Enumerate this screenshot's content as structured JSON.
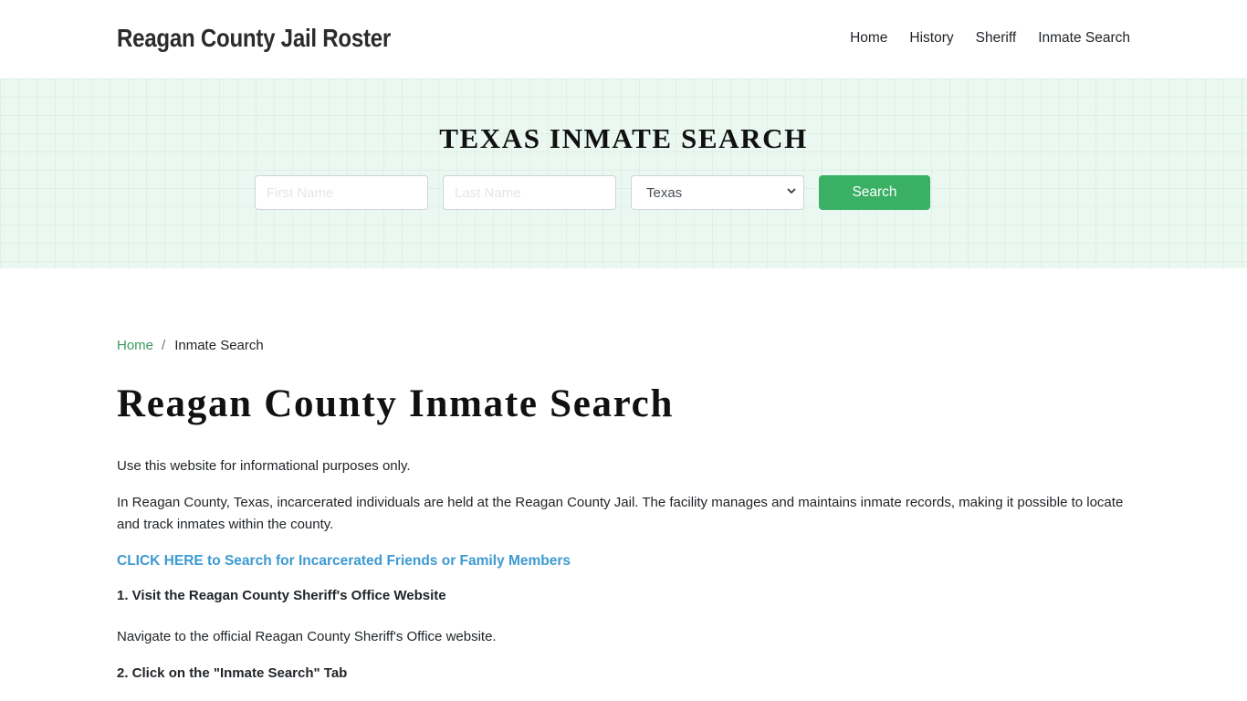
{
  "header": {
    "brand": "Reagan County Jail Roster",
    "nav": [
      {
        "label": "Home"
      },
      {
        "label": "History"
      },
      {
        "label": "Sheriff"
      },
      {
        "label": "Inmate Search"
      }
    ]
  },
  "hero": {
    "title": "TEXAS INMATE SEARCH",
    "first_name_placeholder": "First Name",
    "first_name_value": "",
    "last_name_placeholder": "Last Name",
    "last_name_value": "",
    "state_selected": "Texas",
    "search_label": "Search",
    "colors": {
      "button": "#3ab065",
      "background": "#eaf8f1"
    }
  },
  "breadcrumb": {
    "home": "Home",
    "separator": "/",
    "current": "Inmate Search"
  },
  "main": {
    "title": "Reagan County Inmate Search",
    "disclaimer": "Use this website for informational purposes only.",
    "intro": "In Reagan County, Texas, incarcerated individuals are held at the Reagan County Jail. The facility manages and maintains inmate records, making it possible to locate and track inmates within the county.",
    "cta_link": "CLICK HERE to Search for Incarcerated Friends or Family Members",
    "steps": [
      {
        "heading": "1. Visit the Reagan County Sheriff's Office Website",
        "text": "Navigate to the official Reagan County Sheriff's Office website."
      },
      {
        "heading": "2. Click on the \"Inmate Search\" Tab"
      }
    ],
    "colors": {
      "link": "#3d9ad1",
      "breadcrumb_link": "#3c9b63"
    }
  }
}
